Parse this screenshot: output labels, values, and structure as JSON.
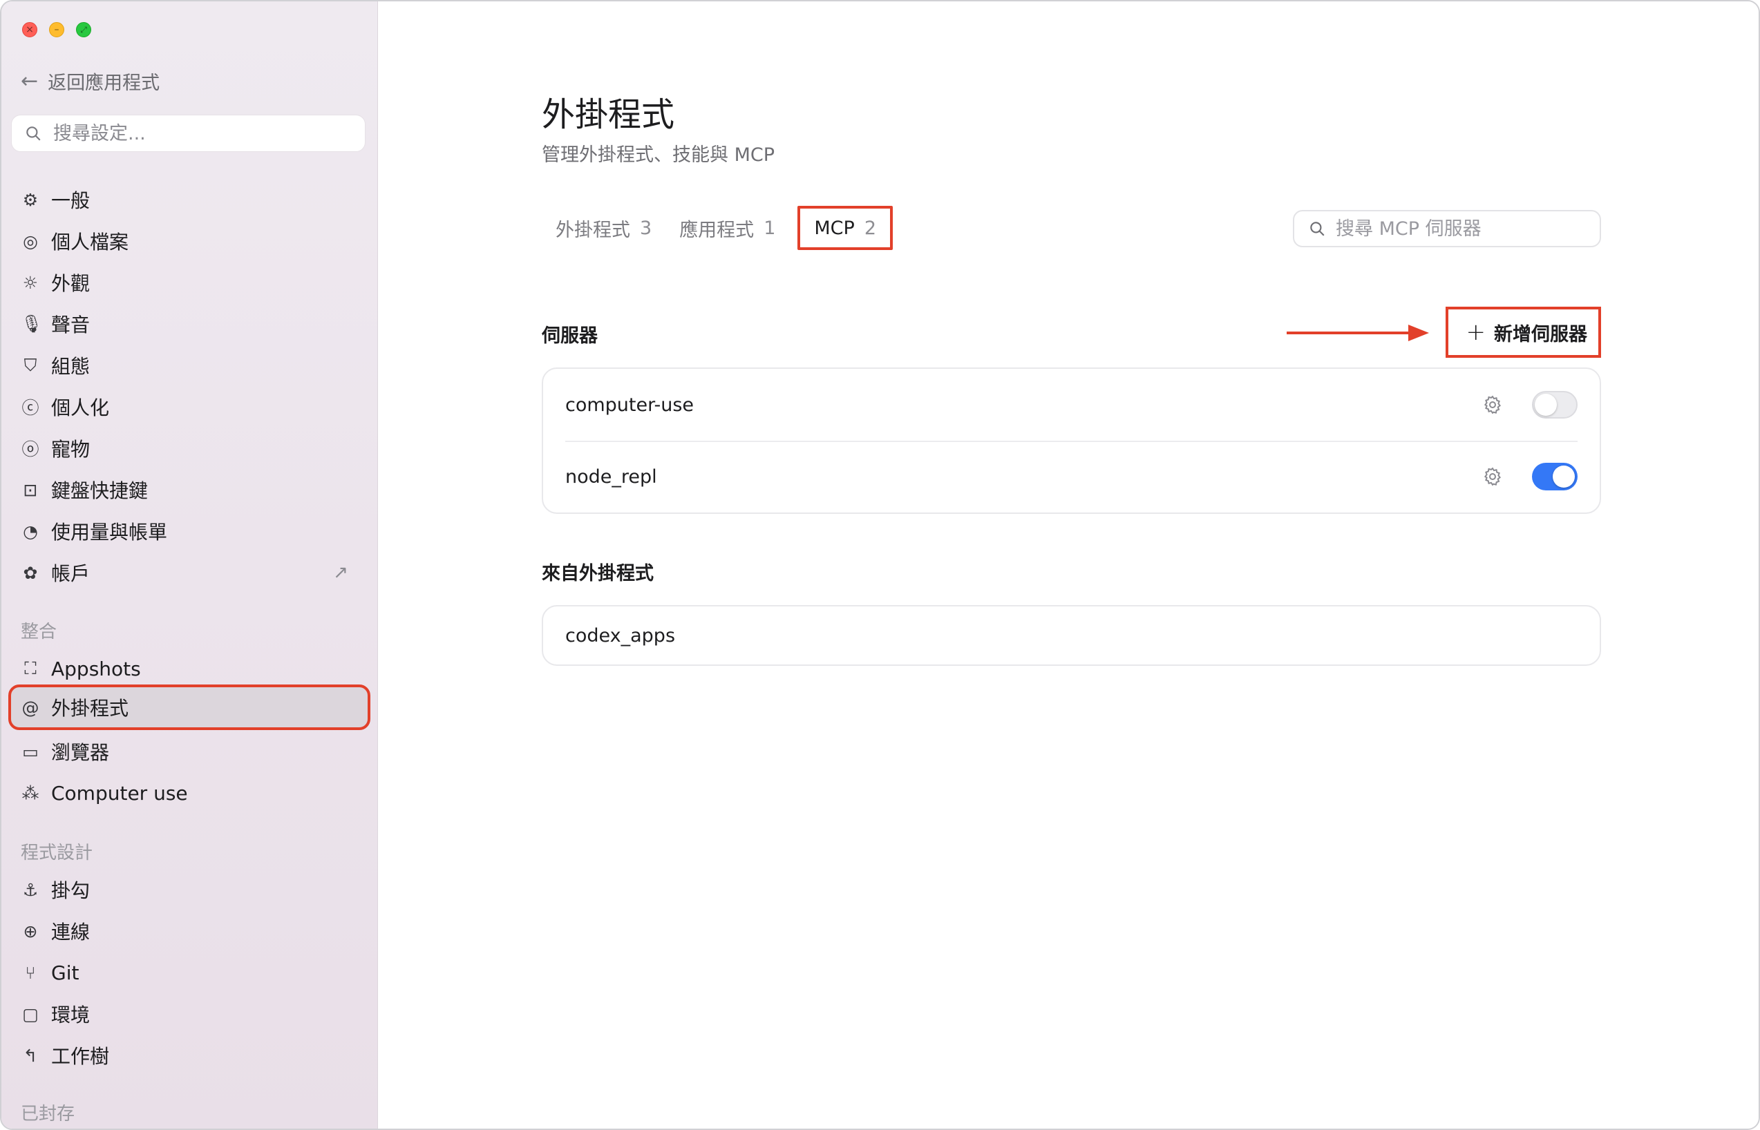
{
  "window_controls": {
    "close": "×",
    "minimize": "–",
    "zoom": "⤢"
  },
  "sidebar": {
    "back_label": "返回應用程式",
    "search_placeholder": "搜尋設定...",
    "items": [
      {
        "label": "一般",
        "icon": "gear-icon"
      },
      {
        "label": "個人檔案",
        "icon": "person-icon"
      },
      {
        "label": "外觀",
        "icon": "sun-icon"
      },
      {
        "label": "聲音",
        "icon": "mic-icon"
      },
      {
        "label": "組態",
        "icon": "shield-icon"
      },
      {
        "label": "個人化",
        "icon": "swirl-icon"
      },
      {
        "label": "寵物",
        "icon": "pet-icon"
      },
      {
        "label": "鍵盤快捷鍵",
        "icon": "lightning-icon"
      },
      {
        "label": "使用量與帳單",
        "icon": "gauge-icon"
      },
      {
        "label": "帳戶",
        "icon": "openai-icon"
      }
    ],
    "section_integrations": "整合",
    "integration_items": [
      {
        "label": "Appshots",
        "icon": "screenshot-icon"
      },
      {
        "label": "外掛程式",
        "icon": "at-icon"
      },
      {
        "label": "瀏覽器",
        "icon": "browser-icon"
      },
      {
        "label": "Computer use",
        "icon": "cursor-click-icon"
      }
    ],
    "section_programming": "程式設計",
    "programming_items": [
      {
        "label": "掛勾",
        "icon": "anchor-icon"
      },
      {
        "label": "連線",
        "icon": "globe-icon"
      },
      {
        "label": "Git",
        "icon": "git-branch-icon"
      },
      {
        "label": "環境",
        "icon": "terminal-icon"
      },
      {
        "label": "工作樹",
        "icon": "worktree-icon"
      }
    ],
    "section_saved": "已封存"
  },
  "main": {
    "title": "外掛程式",
    "subtitle": "管理外掛程式、技能與 MCP",
    "tabs": [
      {
        "label": "外掛程式",
        "count": "3"
      },
      {
        "label": "應用程式",
        "count": "1"
      },
      {
        "label": "MCP",
        "count": "2"
      }
    ],
    "search_placeholder": "搜尋 MCP 伺服器",
    "servers_heading": "伺服器",
    "add_server_label": "新增伺服器",
    "servers": [
      {
        "name": "computer-use",
        "enabled": false
      },
      {
        "name": "node_repl",
        "enabled": true
      }
    ],
    "from_plugins_heading": "來自外掛程式",
    "plugin_servers": [
      {
        "name": "codex_apps"
      }
    ]
  },
  "colors": {
    "accent": "#3478f6",
    "annotation": "#e2402a"
  }
}
